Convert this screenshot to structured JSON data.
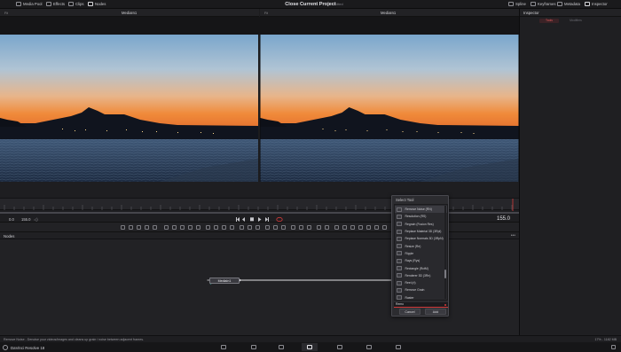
{
  "topbar": {
    "left_items": [
      "Media Pool",
      "Effects",
      "Clips",
      "Nodes"
    ],
    "project_title": "Close Current Project",
    "project_status": "Edited",
    "right_items": [
      "Spline",
      "Keyframes",
      "Metadata",
      "Inspector"
    ]
  },
  "viewers": {
    "left": {
      "zoom": "Fit",
      "name": "MediaIn1",
      "resolution": "3840x2160xfloat32"
    },
    "right": {
      "zoom": "Fit",
      "name": "MediaIn1",
      "resolution": "3840x2160xfloat32"
    }
  },
  "inspector": {
    "title": "Inspector",
    "tabs": [
      "Tools",
      "Modifiers"
    ]
  },
  "transport": {
    "start_frame": "0.0",
    "end_frame": "155.0",
    "timecode": "155.0"
  },
  "nodes": {
    "title": "Nodes",
    "media_node_label": "MediaIn1"
  },
  "select_tool": {
    "title": "Select Tool",
    "items": [
      "Remove Noise (RN)",
      "Resolution (RS)",
      "Regrain (Fusion Res)",
      "Replace Material 3D (3Rpl)",
      "Replace Normals 3D (3RpN)",
      "Resize (Re)",
      "Ripple",
      "Rays (Rys)",
      "Rectangle (RctM)",
      "Renderer 3D (3Rn)",
      "Reel (rl)",
      "Remove Grain",
      "Raster",
      "Reactor",
      "Rig",
      "RoundDiff"
    ],
    "selected_index": 0,
    "search_value": "Remo",
    "cancel_label": "Cancel",
    "add_label": "Add"
  },
  "status": {
    "message": "Remove Noise - Denoise your videos/images and cleans up grain / noise between adjacent frames.",
    "right": "17% - 1182 MB"
  },
  "app": {
    "name": "DaVinci Resolve 18"
  },
  "pages": [
    "Media",
    "Cut",
    "Edit",
    "Fusion",
    "Color",
    "Fairlight",
    "Deliver"
  ],
  "active_page": "Fusion",
  "colors": {
    "accent_red": "#d23a3a",
    "panel": "#1f1f22",
    "sky_top": "#7aa6cc",
    "sky_bottom": "#f08a3a"
  }
}
